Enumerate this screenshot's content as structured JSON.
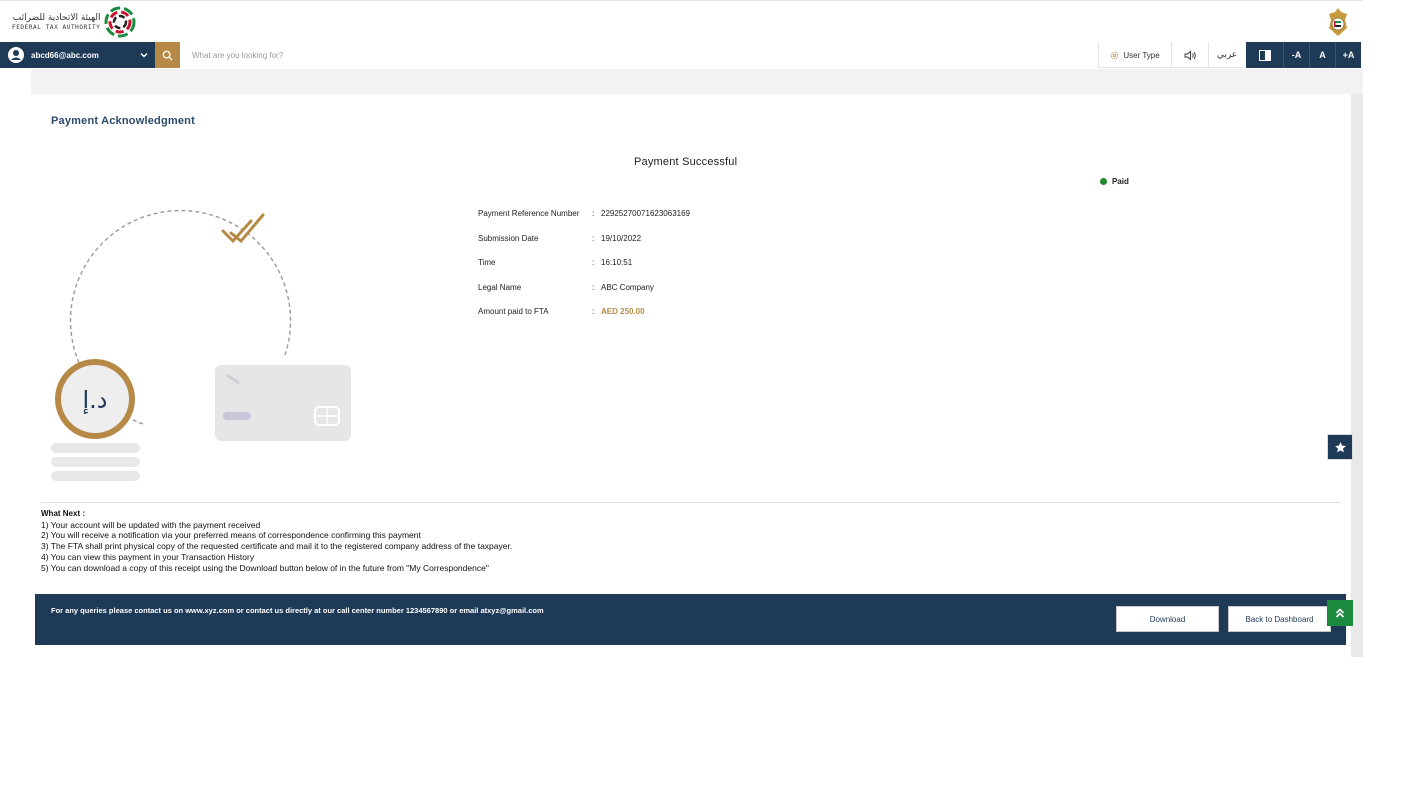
{
  "header": {
    "logo_arabic": "الهيئة الاتحادية للضرائب",
    "logo_english": "FEDERAL TAX AUTHORITY"
  },
  "navbar": {
    "user_email": "abcd66@abc.com",
    "search_placeholder": "What are you looking for?",
    "user_type_label": "User Type",
    "arabic_label": "عربي",
    "font_decrease": "-A",
    "font_normal": "A",
    "font_increase": "+A"
  },
  "page": {
    "title": "Payment Acknowledgment",
    "status_heading": "Payment Successful",
    "status_badge": "Paid",
    "status_color": "#1f8a2e"
  },
  "details": [
    {
      "label": "Payment Reference Number",
      "value": "22925270071623063169"
    },
    {
      "label": "Submission Date",
      "value": "19/10/2022"
    },
    {
      "label": "Time",
      "value": "16:10:51"
    },
    {
      "label": "Legal Name",
      "value": "ABC Company"
    },
    {
      "label": "Amount paid to FTA",
      "value": "AED 250.00"
    }
  ],
  "illustration": {
    "coin_text": "د.إ"
  },
  "what_next": {
    "title": "What Next :",
    "items": [
      "1) Your account will be updated with the payment received",
      "2) You will receive a notification via your preferred means of correspondence confirming this payment",
      "3) The FTA shall print physical copy of the requested certificate and mail it to the registered company address of the taxpayer.",
      "4) You can view this payment in your Transaction History",
      "5) You can download a copy of this receipt using the Download button below of in the future from \"My Correspondence\""
    ]
  },
  "footer": {
    "contact_text": "For any queries please contact us on www.xyz.com or contact us directly at our call center number 1234567890 or email atxyz@gmail.com",
    "download_label": "Download",
    "back_label": "Back to Dashboard"
  },
  "colors": {
    "primary_navy": "#1e3a57",
    "accent_gold": "#b68a46",
    "success_green": "#1b8a3e"
  },
  "icons": [
    "user-avatar-icon",
    "chevron-down-icon",
    "search-icon",
    "settings-icon",
    "speaker-icon",
    "contrast-icon",
    "star-icon",
    "chevrons-up-icon"
  ]
}
